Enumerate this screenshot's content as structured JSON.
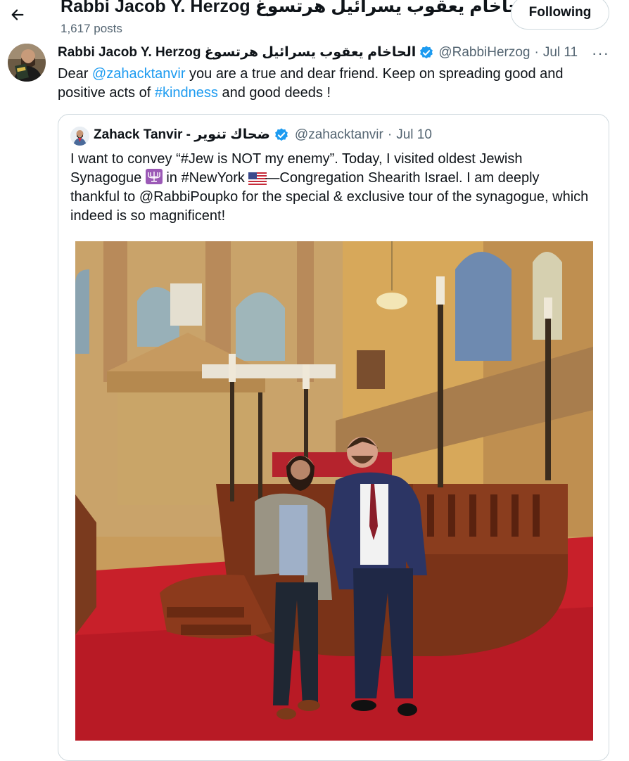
{
  "header": {
    "title": "Rabbi Jacob Y. Herzog حاخام يعقوب يسرائيل هرتسوغ",
    "post_count": "1,617 posts",
    "follow_label": "Following"
  },
  "tweet": {
    "author_name": "Rabbi Jacob Y. Herzog الحاخام يعقوب يسرائيل هرتسوغ",
    "handle": "@RabbiHerzog",
    "separator": "·",
    "date": "Jul 11",
    "more": "···",
    "text": {
      "p1": "Dear ",
      "mention": "@zahacktanvir",
      "p2": " you are a true and dear friend. Keep on spreading good and positive acts of ",
      "hashtag": "#kindness",
      "p3": " and good deeds !"
    }
  },
  "quote": {
    "author_name": "Zahack Tanvir - ضحاك تنوير",
    "handle": "@zahacktanvir",
    "separator": "·",
    "date": "Jul 10",
    "text": {
      "p1": "I want to convey “#Jew is NOT my enemy”. Today, I visited oldest Jewish Synagogue ",
      "p2": " in #NewYork ",
      "p3": "—Congregation Shearith Israel. I am deeply thankful to @RabbiPoupko for the special & exclusive tour of the synagogue, which indeed is so magnificent!"
    }
  },
  "colors": {
    "link": "#1d9bf0",
    "verified": "#1d9bf0",
    "muted": "#536471",
    "carpet": "#c8202a",
    "wood": "#7a3318"
  },
  "icons": [
    "back-arrow-icon",
    "verified-badge-icon",
    "more-icon",
    "menorah-emoji-icon",
    "us-flag-emoji-icon"
  ]
}
